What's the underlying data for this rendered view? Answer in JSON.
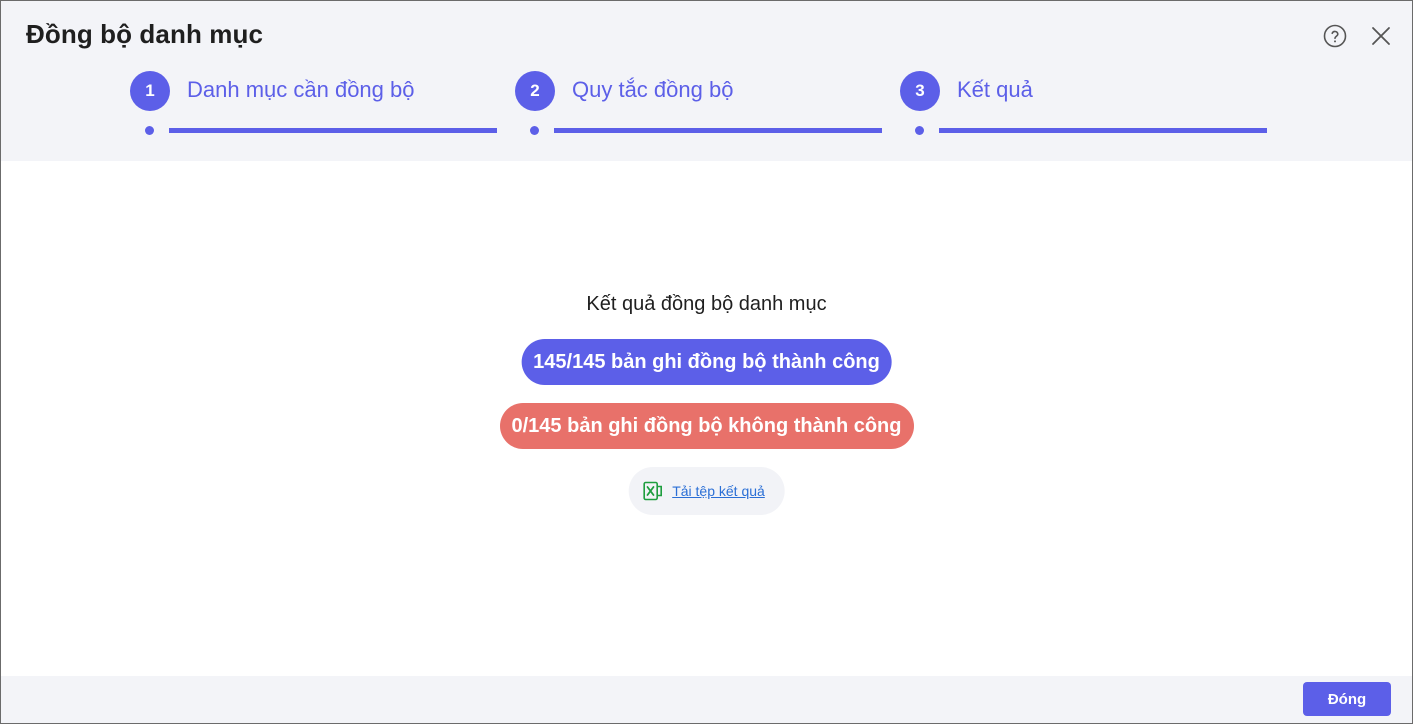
{
  "dialog": {
    "title": "Đồng bộ danh mục",
    "help_icon": "help-circle-icon",
    "close_icon": "close-icon"
  },
  "steps": [
    {
      "number": "1",
      "label": "Danh mục cần đồng bộ"
    },
    {
      "number": "2",
      "label": "Quy tắc đồng bộ"
    },
    {
      "number": "3",
      "label": "Kết quả"
    }
  ],
  "result": {
    "title": "Kết quả đồng bộ danh mục",
    "success_text": "145/145 bản ghi đồng bộ thành công",
    "fail_text": "0/145 bản ghi đồng bộ không thành công",
    "download_label": "Tải tệp kết quả",
    "download_icon": "excel-file-icon"
  },
  "footer": {
    "close_label": "Đóng"
  },
  "colors": {
    "accent": "#5c5fe8",
    "fail": "#e8716a",
    "header_bg": "#f3f4f8",
    "excel_green": "#1e9e3e"
  }
}
